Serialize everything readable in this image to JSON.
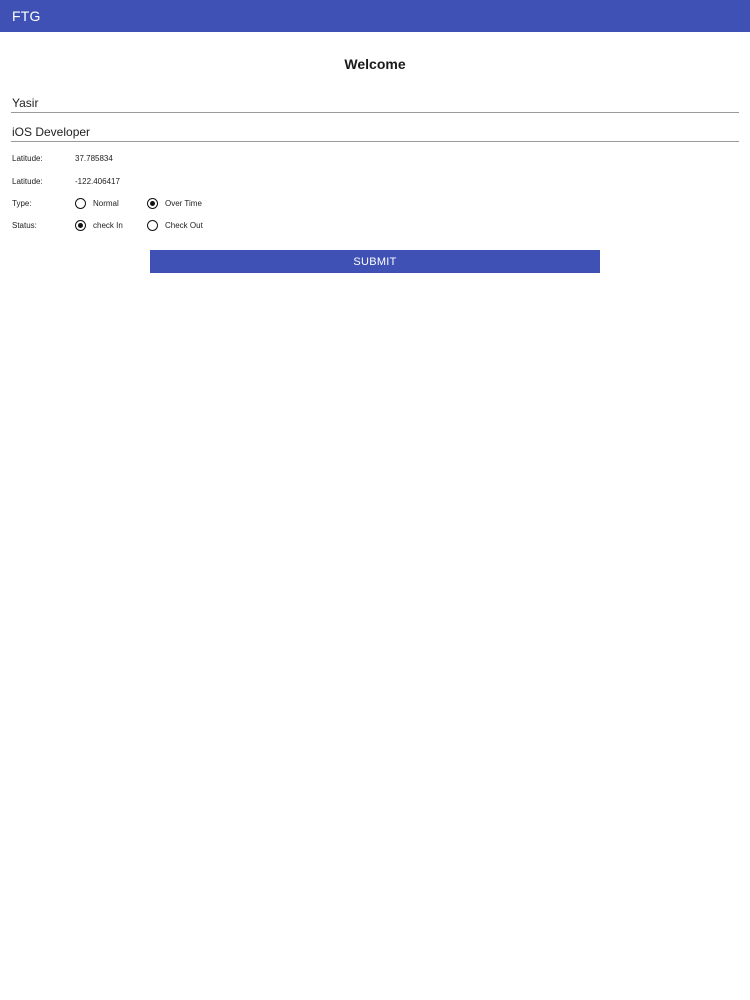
{
  "app_bar": {
    "title": "FTG"
  },
  "page": {
    "title": "Welcome"
  },
  "form": {
    "name_value": "Yasir",
    "role_value": "iOS Developer",
    "latitude": {
      "label": "Latitude:",
      "value": "37.785834"
    },
    "longitude": {
      "label": "Latitude:",
      "value": "-122.406417"
    },
    "type": {
      "label": "Type:",
      "options": [
        {
          "label": "Normal",
          "selected": false
        },
        {
          "label": "Over Time",
          "selected": true
        }
      ]
    },
    "status": {
      "label": "Status:",
      "options": [
        {
          "label": "check In",
          "selected": true
        },
        {
          "label": "Check Out",
          "selected": false
        }
      ]
    },
    "submit_label": "SUBMIT"
  },
  "colors": {
    "primary": "#3f51b5",
    "background": "#ffffff",
    "text": "#222222"
  },
  "icons": {
    "radio_selected": "radio-selected-icon",
    "radio_unselected": "radio-unselected-icon"
  }
}
